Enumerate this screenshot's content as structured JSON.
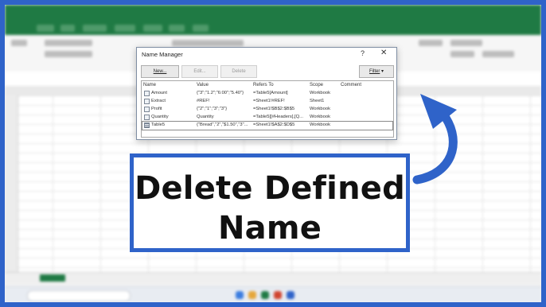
{
  "dialog": {
    "title": "Name Manager",
    "help": "?",
    "close": "✕",
    "buttons": {
      "new": "New...",
      "edit": "Edit...",
      "delete": "Delete",
      "filter": "Filter"
    },
    "columns": [
      "Name",
      "Value",
      "Refers To",
      "Scope",
      "Comment"
    ],
    "rows": [
      {
        "name": "Amount",
        "value": "{\"3\";\"1.2\";\"6:00\";\"5.40\"}",
        "refers_to": "=Table5[Amount]",
        "scope": "Workbook",
        "comment": "",
        "icon": "name-icon"
      },
      {
        "name": "Extract",
        "value": "#REF!",
        "refers_to": "=Sheet1!#REF!",
        "scope": "Sheet1",
        "comment": "",
        "icon": "name-icon"
      },
      {
        "name": "Profit",
        "value": "{\"2\";\"1\";\"3\";\"3\"}",
        "refers_to": "=Sheet1!$B$2:$B$5",
        "scope": "Workbook",
        "comment": "",
        "icon": "name-icon"
      },
      {
        "name": "Quantity",
        "value": "Quantity",
        "refers_to": "=Table5[[#Headers],[Q...",
        "scope": "Workbook",
        "comment": "",
        "icon": "name-icon"
      },
      {
        "name": "Table5",
        "value": "{\"Bread\",\"2\",\"$1.50\",\"3\"...",
        "refers_to": "=Sheet1!$A$2:$D$5",
        "scope": "Workbook",
        "comment": "",
        "icon": "table-icon"
      }
    ]
  },
  "banner": {
    "line1": "Delete Defined",
    "line2": "Name"
  },
  "colors": {
    "frame": "#2f63c9",
    "excel_green": "#1f7a44",
    "arrow": "#2f63c9"
  }
}
